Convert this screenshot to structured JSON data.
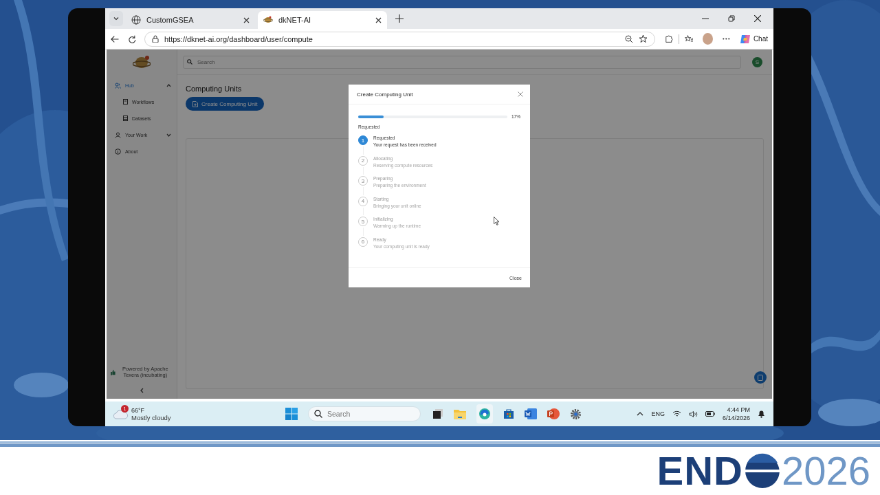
{
  "browser": {
    "tabs": [
      {
        "title": "CustomGSEA",
        "selected": false
      },
      {
        "title": "dkNET-AI",
        "selected": true
      }
    ],
    "url": "https://dknet-ai.org/dashboard/user/compute",
    "chat": "Chat"
  },
  "app": {
    "search_placeholder": "Search",
    "user_initial": "S",
    "sidebar": [
      {
        "label": "Hub",
        "kind": "group",
        "selected": true,
        "expanded": true,
        "children": [
          {
            "label": "Workflows",
            "selected": false
          },
          {
            "label": "Datasets",
            "selected": false
          }
        ]
      },
      {
        "label": "Your Work",
        "kind": "group",
        "selected": false,
        "expanded": false
      },
      {
        "label": "About",
        "kind": "link",
        "selected": false
      }
    ],
    "footer": "Powered by Apache Texera (incubating)",
    "title": "Computing Units",
    "create_button": "Create Computing Unit"
  },
  "modal": {
    "title": "Create Computing Unit",
    "progress": {
      "level": 0.17,
      "reading": "17%"
    },
    "status": "Requested",
    "steps": [
      {
        "number": "1",
        "title": "Requested",
        "detail": "Your request has been received",
        "active": true
      },
      {
        "number": "2",
        "title": "Allocating",
        "detail": "Reserving compute resources",
        "active": false
      },
      {
        "number": "3",
        "title": "Preparing",
        "detail": "Preparing the environment",
        "active": false
      },
      {
        "number": "4",
        "title": "Starting",
        "detail": "Bringing your unit online",
        "active": false
      },
      {
        "number": "5",
        "title": "Initializing",
        "detail": "Warming up the runtime",
        "active": false
      },
      {
        "number": "6",
        "title": "Ready",
        "detail": "Your computing unit is ready",
        "active": false
      }
    ],
    "close": "Close"
  },
  "taskbar": {
    "weather": {
      "badge": "1",
      "temperature": "66°F",
      "condition": "Mostly cloudy"
    },
    "search_placeholder": "Search",
    "language": "ENG",
    "time": "4:44 PM",
    "date": "6/14/2026"
  },
  "logo": {
    "name": "END",
    "year": "2026"
  }
}
